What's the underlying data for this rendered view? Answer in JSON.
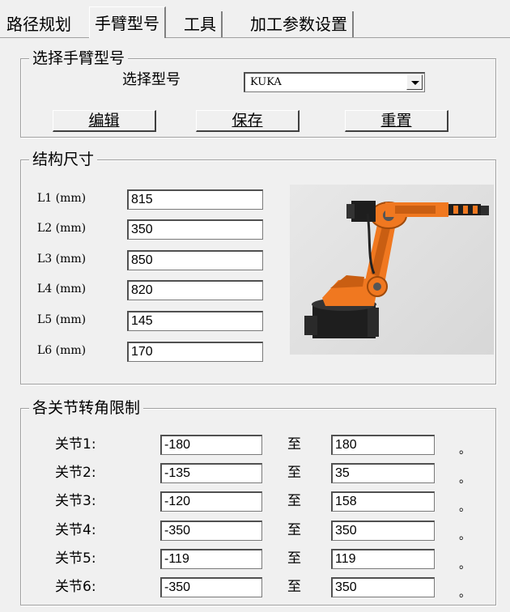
{
  "tabs": [
    {
      "label": "路径规划",
      "active": false
    },
    {
      "label": "手臂型号",
      "active": true
    },
    {
      "label": "工具",
      "active": false
    },
    {
      "label": "加工参数设置",
      "active": false
    }
  ],
  "model_group": {
    "title": "选择手臂型号",
    "select_label": "选择型号",
    "selected_model": "KUKA",
    "buttons": {
      "edit": "编辑",
      "save": "保存",
      "reset": "重置"
    }
  },
  "structure_group": {
    "title": "结构尺寸",
    "rows": [
      {
        "label": "L1 (mm)",
        "value": "815"
      },
      {
        "label": "L2 (mm)",
        "value": "350"
      },
      {
        "label": "L3 (mm)",
        "value": "850"
      },
      {
        "label": "L4 (mm)",
        "value": "820"
      },
      {
        "label": "L5 (mm)",
        "value": "145"
      },
      {
        "label": "L6 (mm)",
        "value": "170"
      }
    ]
  },
  "joints_group": {
    "title": "各关节转角限制",
    "to_label": "至",
    "unit": "。",
    "rows": [
      {
        "label": "关节1:",
        "min": "-180",
        "max": "180"
      },
      {
        "label": "关节2:",
        "min": "-135",
        "max": "35"
      },
      {
        "label": "关节3:",
        "min": "-120",
        "max": "158"
      },
      {
        "label": "关节4:",
        "min": "-350",
        "max": "350"
      },
      {
        "label": "关节5:",
        "min": "-119",
        "max": "119"
      },
      {
        "label": "关节6:",
        "min": "-350",
        "max": "350"
      }
    ]
  },
  "colors": {
    "robot_orange": "#f07820",
    "robot_dark": "#1e1e1e",
    "panel_bg": "#f0f0f0"
  }
}
